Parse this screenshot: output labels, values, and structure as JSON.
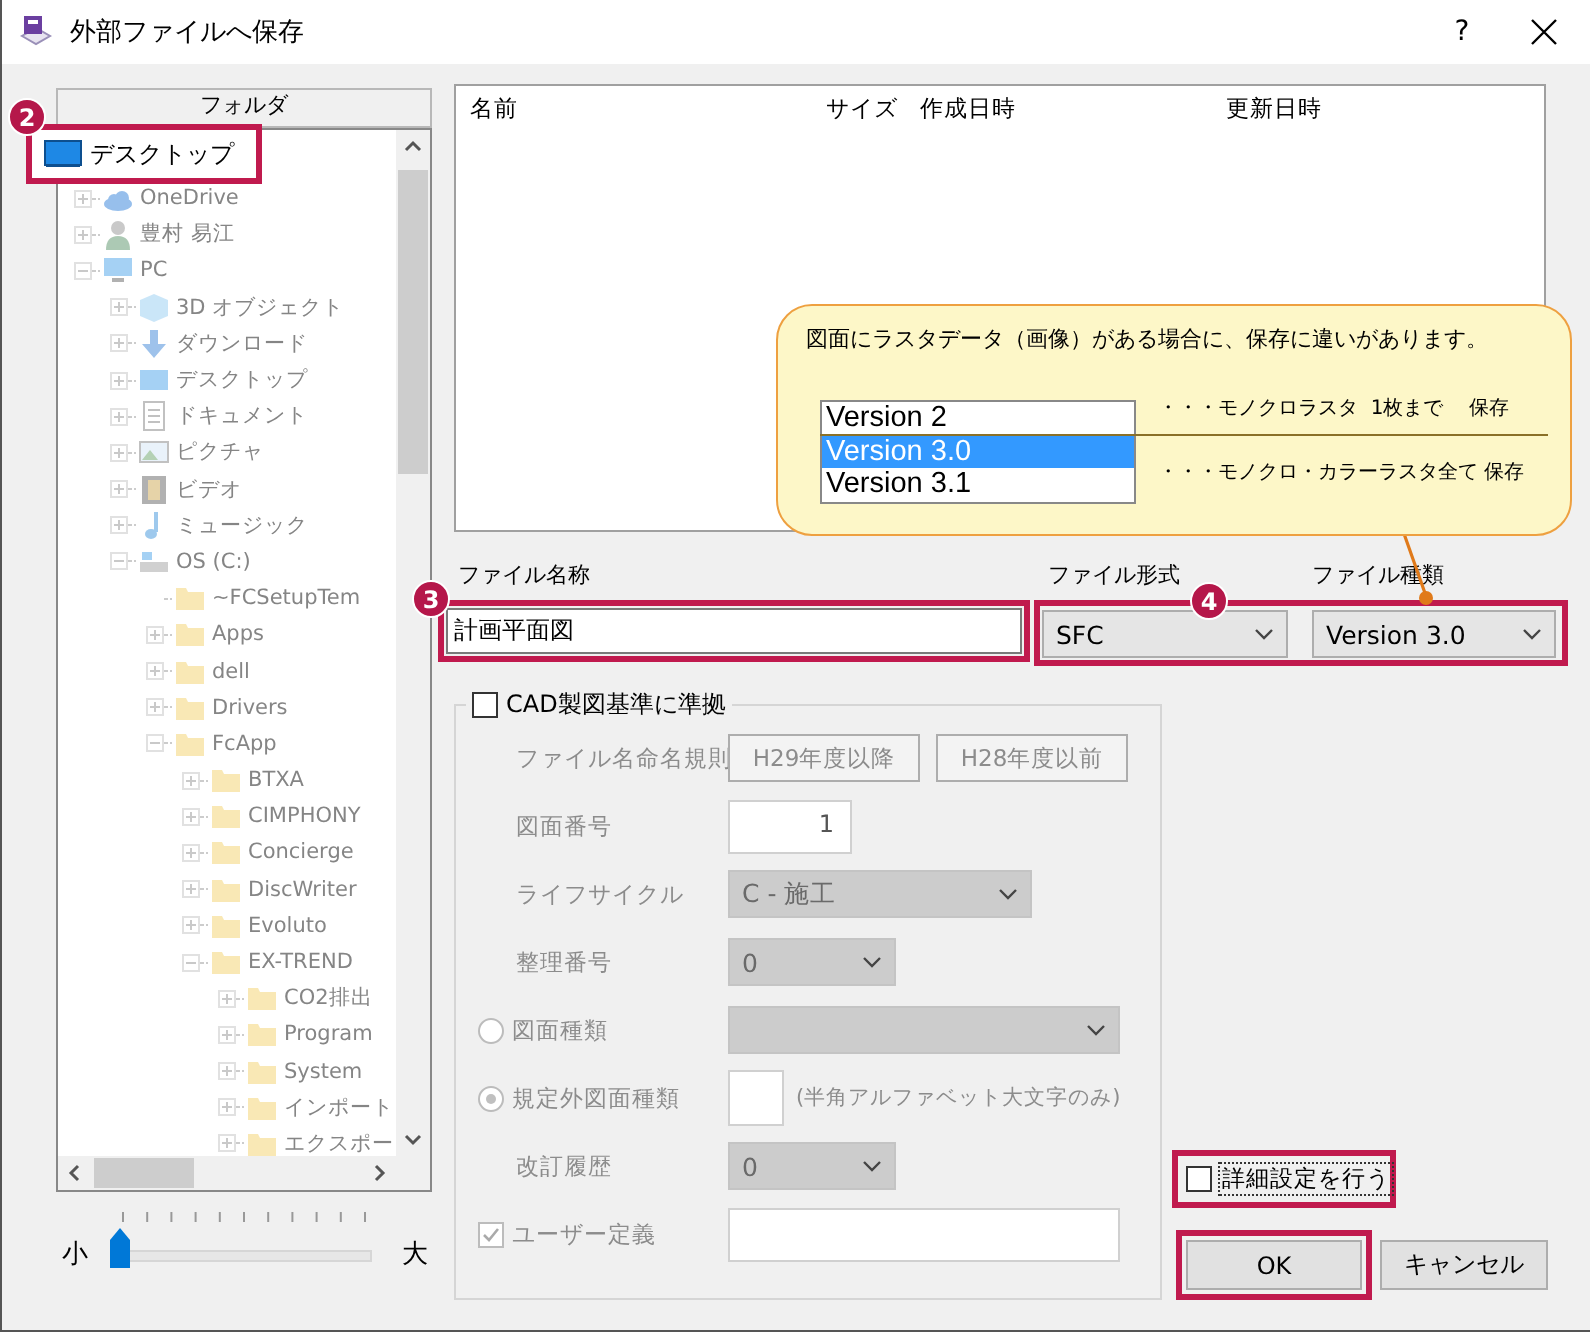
{
  "window": {
    "title": "外部ファイルへ保存",
    "help_label": "?"
  },
  "folder_panel": {
    "header": "フォルダ",
    "highlighted_item": {
      "badge": "2",
      "label": "デスクトップ"
    },
    "tree": [
      {
        "label": "OneDrive",
        "kind": "cloud",
        "expanded": false
      },
      {
        "label": "豊村 易江",
        "kind": "user",
        "expanded": false
      },
      {
        "label": "PC",
        "kind": "computer",
        "expanded": true,
        "children": [
          {
            "label": "3D オブジェクト",
            "kind": "cube",
            "expanded": false
          },
          {
            "label": "ダウンロード",
            "kind": "download",
            "expanded": false
          },
          {
            "label": "デスクトップ",
            "kind": "desktop",
            "expanded": false
          },
          {
            "label": "ドキュメント",
            "kind": "document",
            "expanded": false
          },
          {
            "label": "ピクチャ",
            "kind": "picture",
            "expanded": false
          },
          {
            "label": "ビデオ",
            "kind": "video",
            "expanded": false
          },
          {
            "label": "ミュージック",
            "kind": "music",
            "expanded": false
          },
          {
            "label": "OS (C:)",
            "kind": "drive",
            "expanded": true,
            "children": [
              {
                "label": "~FCSetupTem",
                "kind": "folder"
              },
              {
                "label": "Apps",
                "kind": "folder",
                "expanded": false
              },
              {
                "label": "dell",
                "kind": "folder",
                "expanded": false
              },
              {
                "label": "Drivers",
                "kind": "folder",
                "expanded": false
              },
              {
                "label": "FcApp",
                "kind": "folder",
                "expanded": true,
                "children": [
                  {
                    "label": "BTXA",
                    "kind": "folder",
                    "expanded": false
                  },
                  {
                    "label": "CIMPHONY",
                    "kind": "folder",
                    "expanded": false
                  },
                  {
                    "label": "Concierge",
                    "kind": "folder",
                    "expanded": false
                  },
                  {
                    "label": "DiscWriter",
                    "kind": "folder",
                    "expanded": false
                  },
                  {
                    "label": "Evoluto",
                    "kind": "folder",
                    "expanded": false
                  },
                  {
                    "label": "EX-TREND",
                    "kind": "folder",
                    "expanded": true,
                    "children": [
                      {
                        "label": "CO2排出",
                        "kind": "folder",
                        "expanded": false
                      },
                      {
                        "label": "Program",
                        "kind": "folder",
                        "expanded": false
                      },
                      {
                        "label": "System",
                        "kind": "folder",
                        "expanded": false
                      },
                      {
                        "label": "インポート",
                        "kind": "folder",
                        "expanded": false
                      },
                      {
                        "label": "エクスポー",
                        "kind": "folder",
                        "expanded": false
                      }
                    ]
                  }
                ]
              }
            ]
          }
        ]
      }
    ],
    "zoom_slider": {
      "min_label": "小",
      "max_label": "大",
      "level": 0
    }
  },
  "file_list": {
    "columns": [
      "名前",
      "サイズ",
      "作成日時",
      "更新日時"
    ]
  },
  "callout": {
    "message": "図面にラスタデータ（画像）がある場合に、保存に違いがあります。",
    "versions": [
      {
        "label": "Version 2",
        "selected": false
      },
      {
        "label": "Version 3.0",
        "selected": true
      },
      {
        "label": "Version 3.1",
        "selected": false
      }
    ],
    "notes": [
      "・・・モノクロラスタ  1枚まで    保存",
      "・・・モノクロ・カラーラスタ全て 保存"
    ]
  },
  "file_name": {
    "label": "ファイル名称",
    "value": "計画平面図",
    "highlighted": true,
    "badge": "3"
  },
  "file_format": {
    "label": "ファイル形式",
    "value": "SFC"
  },
  "file_type": {
    "label": "ファイル種類",
    "value": "Version 3.0"
  },
  "format_group": {
    "highlighted": true,
    "badge": "4"
  },
  "cad_standard": {
    "label": "CAD製図基準に準拠",
    "checked": false,
    "rows": [
      {
        "kind": "buttons",
        "label": "ファイル名命名規則",
        "buttons": [
          "H29年度以降",
          "H28年度以前"
        ]
      },
      {
        "kind": "number",
        "label": "図面番号",
        "value": "1"
      },
      {
        "kind": "select",
        "label": "ライフサイクル",
        "value": "C - 施工"
      },
      {
        "kind": "select",
        "label": "整理番号",
        "value": "0"
      },
      {
        "kind": "radio_select",
        "label": "図面種類",
        "selected": false
      },
      {
        "kind": "radio_field",
        "label": "規定外図面種類",
        "selected": true,
        "note": "(半角アルファベット大文字のみ)"
      },
      {
        "kind": "select",
        "label": "改訂履歴",
        "value": "0"
      },
      {
        "kind": "checkbox_field",
        "label": "ユーザー定義",
        "checked": true
      }
    ]
  },
  "advanced": {
    "label": "詳細設定を行う",
    "checked": false,
    "highlighted": true
  },
  "buttons": [
    {
      "label": "OK",
      "highlighted": true
    },
    {
      "label": "キャンセル",
      "highlighted": false
    }
  ]
}
